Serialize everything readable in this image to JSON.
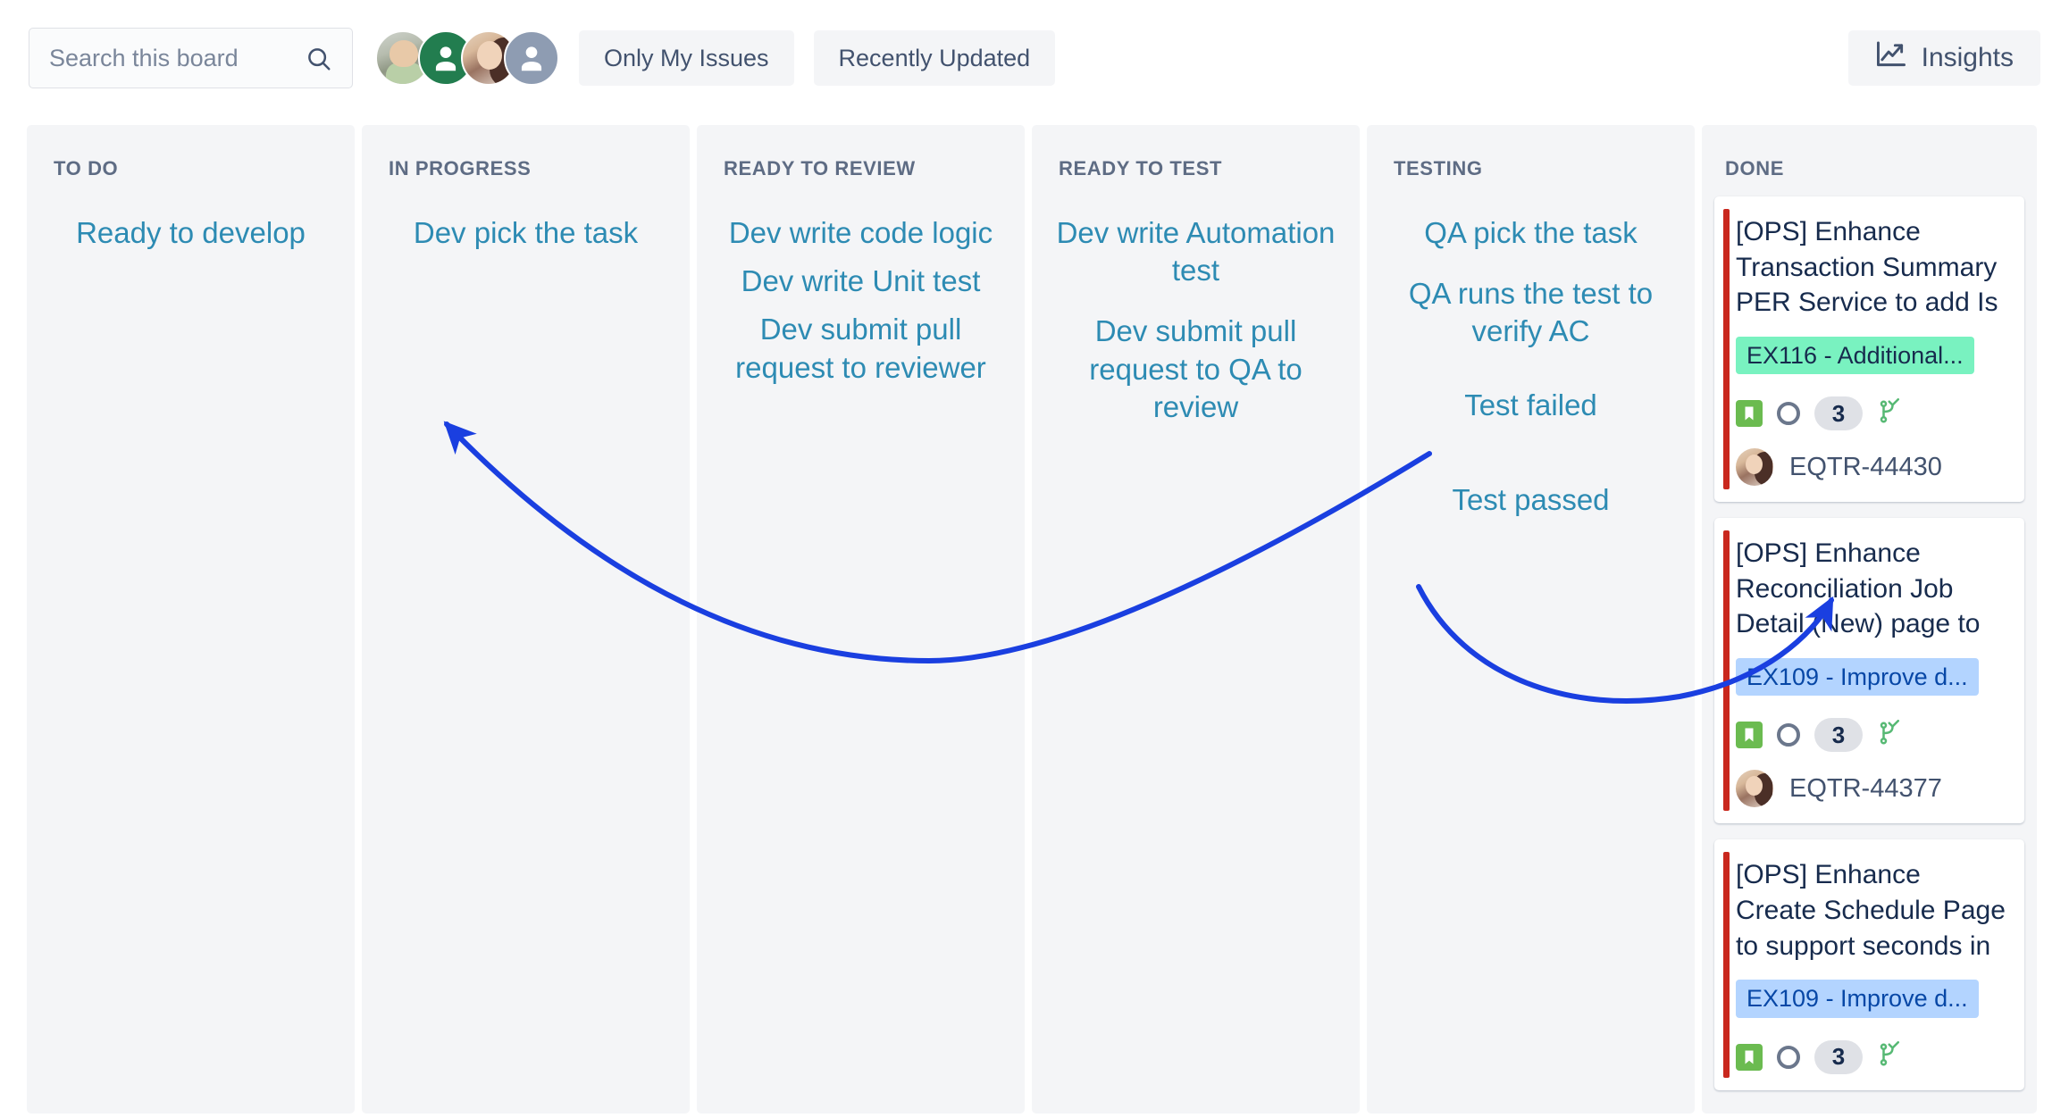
{
  "toolbar": {
    "search": {
      "placeholder": "Search this board",
      "value": ""
    },
    "search_icon": "search-icon",
    "avatars": [
      {
        "type": "photo",
        "name": "avatar-user-1"
      },
      {
        "type": "default-green",
        "name": "avatar-user-2"
      },
      {
        "type": "photo",
        "name": "avatar-user-3"
      },
      {
        "type": "default-gray",
        "name": "avatar-user-4"
      }
    ],
    "filters": [
      {
        "label": "Only My Issues"
      },
      {
        "label": "Recently Updated"
      }
    ],
    "insights": {
      "label": "Insights",
      "icon": "trend-chart-icon"
    }
  },
  "columns": [
    {
      "title": "TO DO",
      "notes": [
        "Ready to develop"
      ],
      "cards": []
    },
    {
      "title": "IN PROGRESS",
      "notes": [
        "Dev pick the task"
      ],
      "cards": []
    },
    {
      "title": "READY TO REVIEW",
      "notes": [
        "Dev write code logic",
        "Dev write Unit test",
        "Dev submit pull request to reviewer"
      ],
      "cards": []
    },
    {
      "title": "READY TO TEST",
      "notes": [
        "Dev write Automation test",
        "Dev submit pull request to QA to review"
      ],
      "cards": []
    },
    {
      "title": "TESTING",
      "notes": [
        "QA pick the task",
        "QA  runs the test to verify AC",
        "Test failed",
        "Test passed"
      ],
      "cards": []
    },
    {
      "title": "DONE",
      "notes": [],
      "cards": [
        {
          "title": "[OPS] Enhance Transaction Summary PER Service to add Is",
          "epic": {
            "label": "EX116 - Additional...",
            "style": "green"
          },
          "type_icon": "story-bookmark-icon",
          "priority_icon": "priority-circle-icon",
          "points": "3",
          "branch_icon": "branch-merged-icon",
          "assignee_avatar": "avatar-assignee",
          "issue_key": "EQTR-44430"
        },
        {
          "title": "[OPS] Enhance Reconciliation Job Detail (New) page to",
          "epic": {
            "label": "EX109 - Improve d...",
            "style": "blue"
          },
          "type_icon": "story-bookmark-icon",
          "priority_icon": "priority-circle-icon",
          "points": "3",
          "branch_icon": "branch-merged-icon",
          "assignee_avatar": "avatar-assignee",
          "issue_key": "EQTR-44377"
        },
        {
          "title": "[OPS] Enhance Create Schedule Page to support seconds in",
          "epic": {
            "label": "EX109 - Improve d...",
            "style": "blue"
          },
          "type_icon": "story-bookmark-icon",
          "priority_icon": "priority-circle-icon",
          "points": "3",
          "branch_icon": "branch-merged-icon",
          "assignee_avatar": "avatar-assignee",
          "issue_key": ""
        }
      ]
    }
  ],
  "annotations": {
    "arrow_color": "#1a3fe0",
    "note_color": "#2d8bb3",
    "arrows": [
      {
        "name": "test-failed-arrow",
        "from": "Test failed",
        "to": "IN PROGRESS"
      },
      {
        "name": "test-passed-arrow",
        "from": "Test passed",
        "to": "DONE card 2"
      }
    ]
  },
  "colors": {
    "column_bg": "#f4f5f7",
    "card_bg": "#ffffff",
    "card_stripe": "#c9281e",
    "epic_green": "#79f2c0",
    "epic_blue": "#b3d4ff",
    "text_dark": "#172b4d",
    "text_muted": "#5e6c84"
  }
}
